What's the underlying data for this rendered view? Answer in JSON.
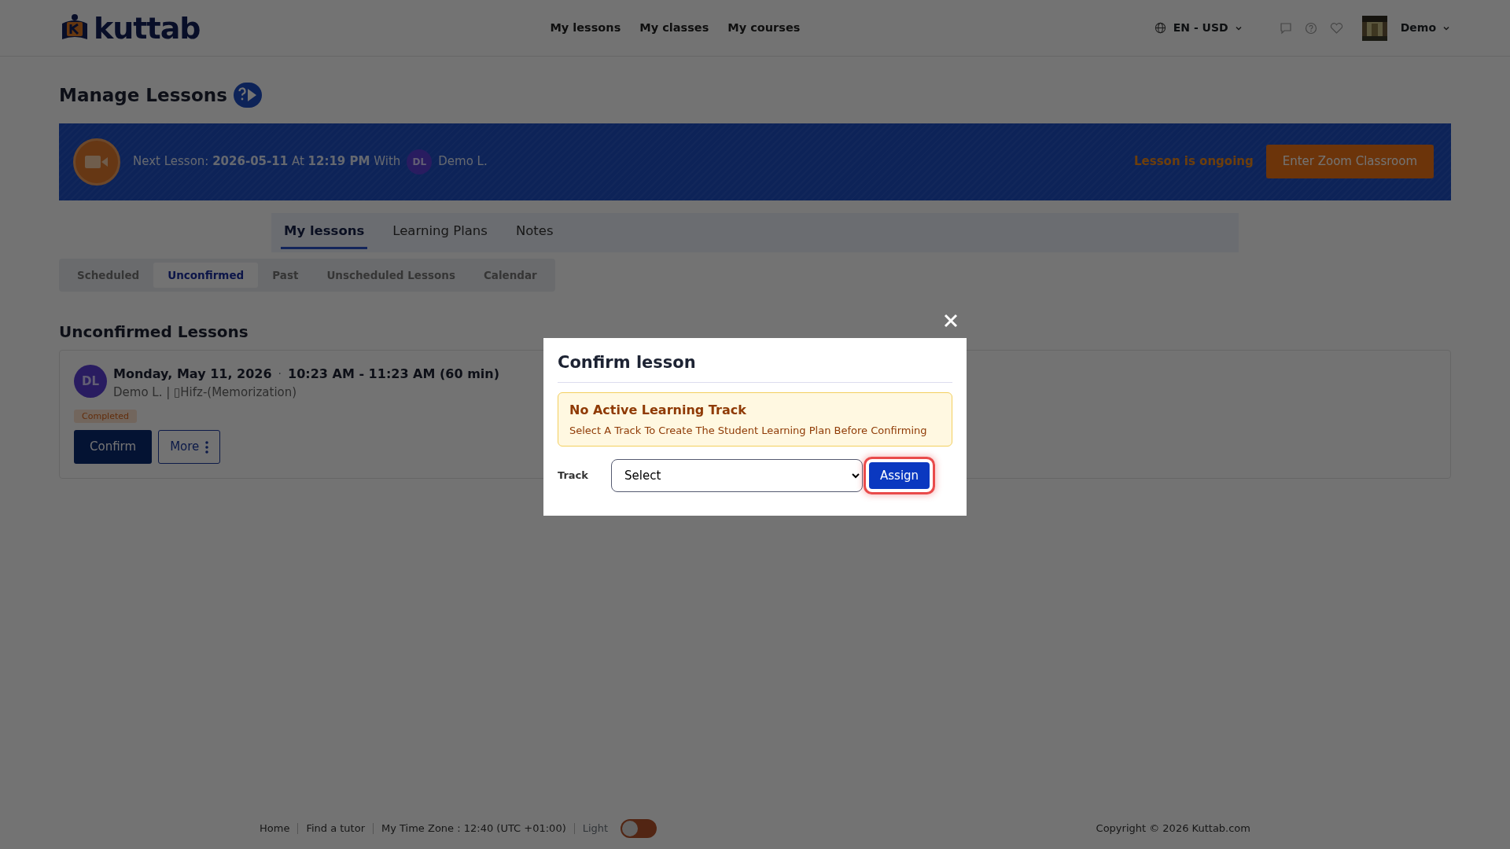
{
  "header": {
    "logo_text": "kuttab",
    "nav": [
      {
        "label": "My lessons"
      },
      {
        "label": "My classes"
      },
      {
        "label": "My courses"
      }
    ],
    "locale": "EN - USD",
    "user": "Demo"
  },
  "page_title": "Manage Lessons",
  "banner": {
    "text": "Next Lesson: **2026-05-11** At **12:19 PM** With",
    "initials": "DL",
    "name": "Demo L.",
    "status": "Lesson is ongoing",
    "button": "Enter Zoom Classroom"
  },
  "tabs": [
    {
      "label": "My lessons",
      "selected": true
    },
    {
      "label": "Learning Plans",
      "selected": false
    },
    {
      "label": "Notes",
      "selected": false
    }
  ],
  "subtabs": [
    {
      "label": "Scheduled",
      "selected": false
    },
    {
      "label": "Unconfirmed",
      "selected": true
    },
    {
      "label": "Past",
      "selected": false
    },
    {
      "label": "Unscheduled Lessons",
      "selected": false
    },
    {
      "label": "Calendar",
      "selected": false
    }
  ],
  "section_title": "Unconfirmed Lessons",
  "lessons": [
    {
      "initials": "DL",
      "date": "Monday, May 11, 2026",
      "separator": "·",
      "time": "10:23 AM - 11:23 AM (60 min)",
      "subtitle": "Demo L. | ▯Hifz-(Memorization)",
      "badge": "Completed",
      "buttons": [
        "Confirm",
        "More"
      ]
    }
  ],
  "modal": {
    "title": "Confirm lesson",
    "alert_title": "No Active Learning Track",
    "alert_text": "Select A Track To Create The Student Learning Plan Before Confirming",
    "field_label": "Track",
    "field_value": "Select",
    "button": "Assign"
  },
  "footer": {
    "links": [
      "Home",
      "Find a tutor",
      "My Time Zone : 12:40 (UTC +01:00)"
    ],
    "theme_label": "Light",
    "theme_on": false,
    "copyright": "Copyright © 2026 Kuttab.com"
  }
}
